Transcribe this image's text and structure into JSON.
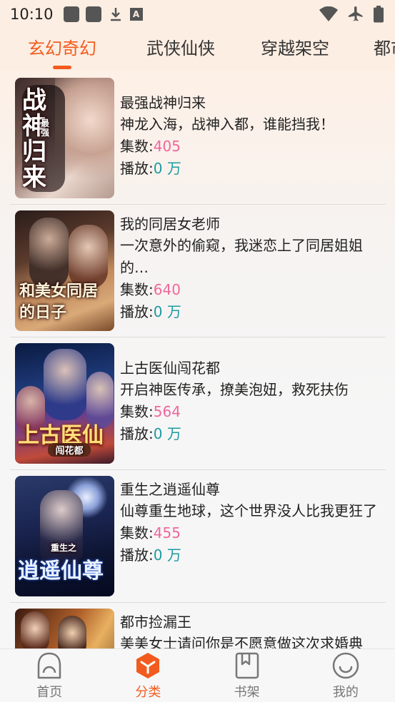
{
  "status_bar": {
    "time": "10:10"
  },
  "tabs": [
    {
      "label": "玄幻奇幻",
      "active": true
    },
    {
      "label": "武侠仙侠",
      "active": false
    },
    {
      "label": "穿越架空",
      "active": false
    },
    {
      "label": "都市",
      "active": false
    }
  ],
  "books": [
    {
      "title": "最强战神归来",
      "desc": "神龙入海，战神入都，谁能挡我！",
      "episodes_label": "集数:",
      "episodes": "405",
      "plays_label": "播放:",
      "plays": "0 万",
      "cover_text": "战神归来",
      "cover_small": "最强"
    },
    {
      "title": "我的同居女老师",
      "desc": "一次意外的偷窥，我迷恋上了同居姐姐的…",
      "episodes_label": "集数:",
      "episodes": "640",
      "plays_label": "播放:",
      "plays": "0 万",
      "cover_text": "和美女同居的日子",
      "cover_small": ""
    },
    {
      "title": "上古医仙闯花都",
      "desc": "开启神医传承，撩美泡妞，救死扶伤",
      "episodes_label": "集数:",
      "episodes": "564",
      "plays_label": "播放:",
      "plays": "0 万",
      "cover_text": "上古医仙",
      "cover_small": "闯花都"
    },
    {
      "title": "重生之逍遥仙尊",
      "desc": "仙尊重生地球，这个世界没人比我更狂了",
      "episodes_label": "集数:",
      "episodes": "455",
      "plays_label": "播放:",
      "plays": "0 万",
      "cover_text": "逍遥仙尊",
      "cover_small": "重生之"
    },
    {
      "title": "都市捡漏王",
      "desc": "美美女士请问你是不愿意做这次求婚典",
      "episodes_label": "",
      "episodes": "",
      "plays_label": "",
      "plays": "",
      "cover_text": "",
      "cover_small": ""
    }
  ],
  "bottom_nav": [
    {
      "label": "首页",
      "icon": "home-icon",
      "active": false
    },
    {
      "label": "分类",
      "icon": "category-icon",
      "active": true
    },
    {
      "label": "书架",
      "icon": "bookshelf-icon",
      "active": false
    },
    {
      "label": "我的",
      "icon": "profile-icon",
      "active": false
    }
  ],
  "colors": {
    "accent": "#f25b1d",
    "episodes": "#f0679c",
    "plays": "#1d9aa0"
  }
}
